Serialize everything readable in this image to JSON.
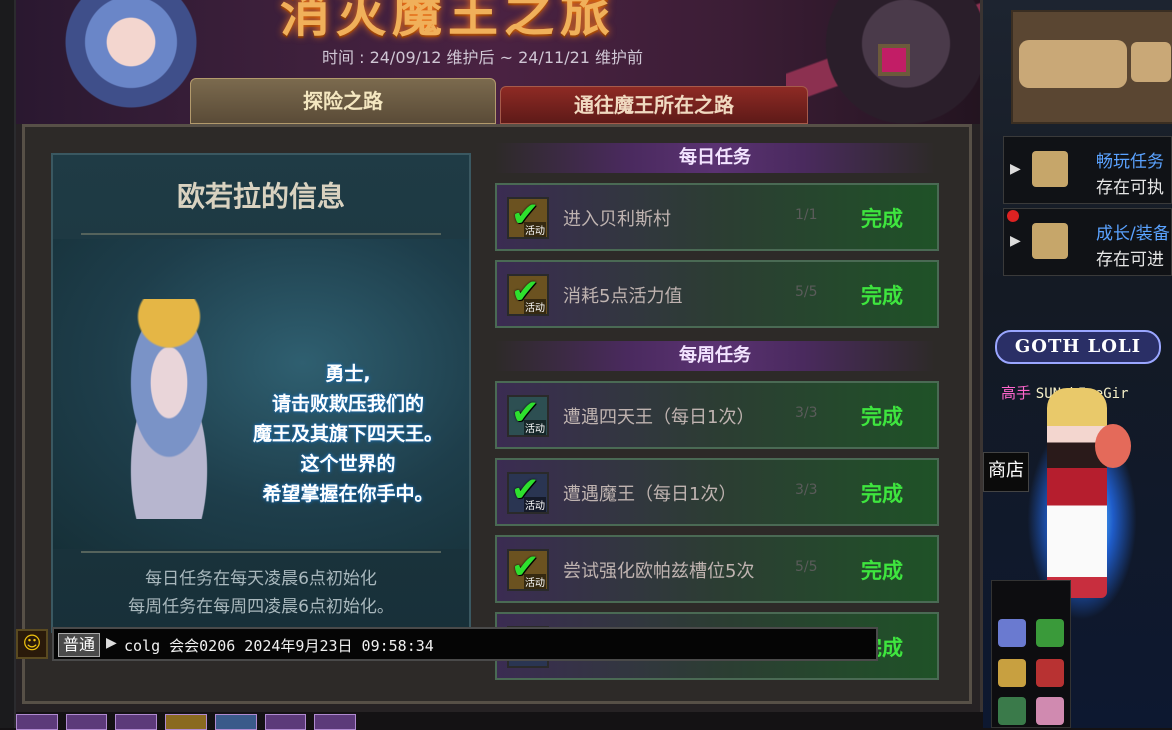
{
  "event": {
    "title": "消灭魔王之旅",
    "period": "时间 : 24/09/12 维护后 ~ 24/11/21 维护前",
    "tabs": [
      {
        "label": "探险之路",
        "active": true
      },
      {
        "label": "通往魔王所在之路",
        "active": false
      }
    ]
  },
  "npc": {
    "title": "欧若拉的信息",
    "speech": [
      "勇士,",
      "请击败欺压我们的",
      "魔王及其旗下四天王。",
      "这个世界的",
      "希望掌握在你手中。"
    ],
    "notes": [
      "每日任务在每天凌晨6点初始化",
      "每周任务在每周四凌晨6点初始化。"
    ]
  },
  "quests": {
    "daily_header": "每日任务",
    "weekly_header": "每周任务",
    "icon_tag": "活动",
    "daily": [
      {
        "name": "进入贝利斯村",
        "progress": "1/1",
        "status": "完成",
        "icon": "gold"
      },
      {
        "name": "消耗5点活力值",
        "progress": "5/5",
        "status": "完成",
        "icon": "gold"
      }
    ],
    "weekly": [
      {
        "name": "遭遇四天王（每日1次）",
        "progress": "3/3",
        "status": "完成",
        "icon": "teal"
      },
      {
        "name": "遭遇魔王（每日1次）",
        "progress": "3/3",
        "status": "完成",
        "icon": "navy"
      },
      {
        "name": "尝试强化欧帕兹槽位5次",
        "progress": "5/5",
        "status": "完成",
        "icon": "gold"
      },
      {
        "name": "",
        "progress": "",
        "status": "完成",
        "icon": "navy"
      }
    ]
  },
  "chat": {
    "channel": "普通",
    "message": "colg 会会0206 2024年9月23日 09:58:34"
  },
  "game": {
    "trackers": [
      {
        "line1": "畅玩任务",
        "line2": "存在可执"
      },
      {
        "line1": "成长/装备",
        "line2": "存在可进"
      }
    ],
    "guild": "GOTH LOLI",
    "player_title": "高手",
    "player_name": "SUNshIneGir",
    "shop_label": "商店"
  },
  "colors": {
    "complete_green": "#3ee53e",
    "player_pink": "#ff66cc",
    "tracker_blue": "#5aa2ff"
  }
}
